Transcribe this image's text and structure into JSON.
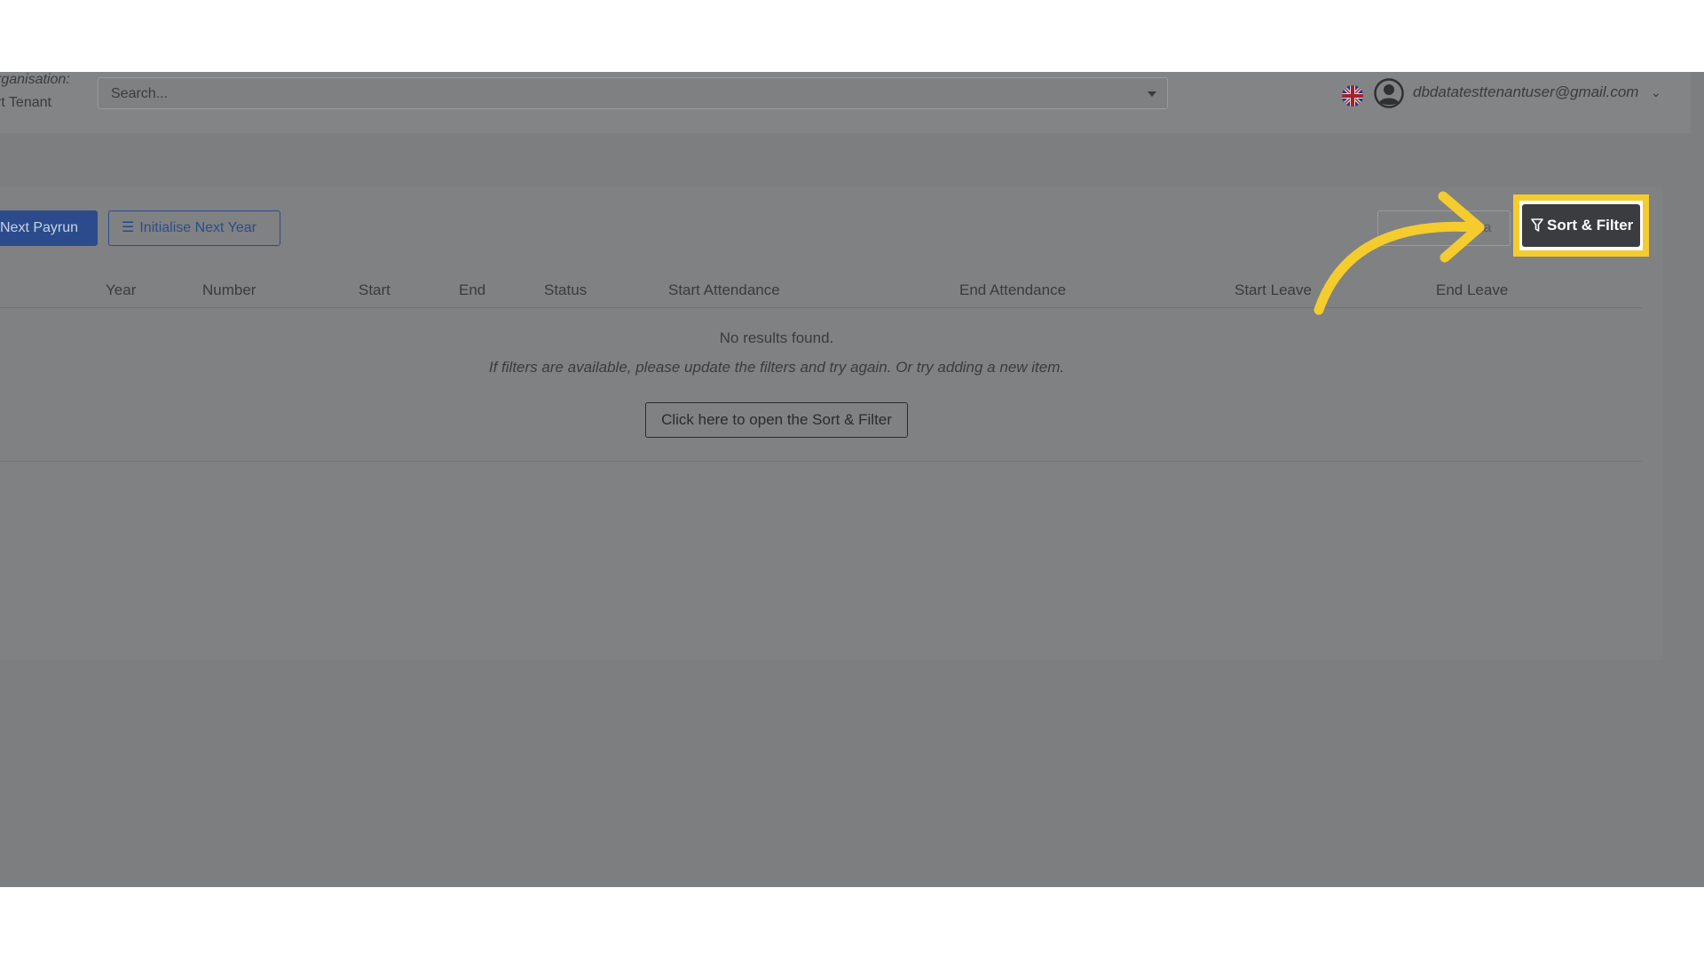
{
  "header": {
    "org_label": "rganisation:",
    "org_name": "rt Tenant",
    "search_placeholder": "Search...",
    "user_email": "dbdatatesttenantuser@gmail.com"
  },
  "toolbar": {
    "next_payrun_label": "Next Payrun",
    "initialise_next_year_label": "Initialise Next Year",
    "dim_button_label": "ta",
    "sort_filter_label": "Sort & Filter"
  },
  "table": {
    "columns": [
      "Year",
      "Number",
      "Start",
      "End",
      "Status",
      "Start Attendance",
      "End Attendance",
      "Start Leave",
      "End Leave"
    ]
  },
  "empty_state": {
    "title": "No results found.",
    "subtitle": "If filters are available, please update the filters and try again. Or try adding a new item.",
    "open_button_label": "Click here to open the Sort & Filter"
  },
  "colors": {
    "highlight": "#f4cc2d",
    "primary": "#2c4b8c",
    "overlay": "#7d7e80"
  },
  "icons": {
    "search_caret": "chevron-down-icon",
    "flag": "uk-flag-icon",
    "avatar": "user-avatar-icon",
    "list": "list-icon",
    "filter": "filter-icon",
    "arrow": "curved-arrow-icon"
  }
}
